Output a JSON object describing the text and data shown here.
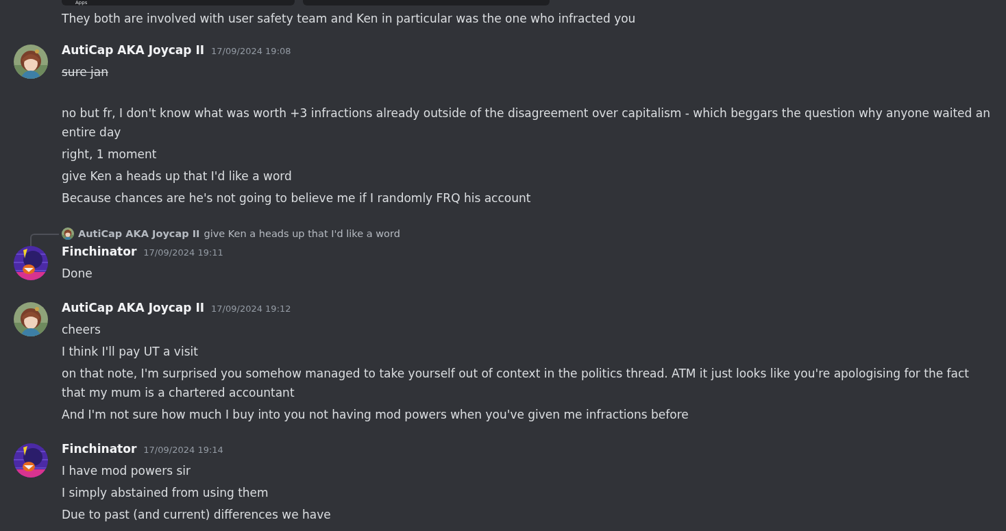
{
  "embed_strip": {
    "label": "Apps"
  },
  "continued_messages": [
    {
      "text": "They both are involved with user safety team and Ken in particular was the one who infracted you",
      "strikethrough": false
    }
  ],
  "groups": [
    {
      "author": "AutiCap AKA Joycap II",
      "avatar": {
        "kind": "auticap"
      },
      "timestamp": "17/09/2024 19:08",
      "messages": [
        {
          "text": "sure jan",
          "strikethrough": true
        },
        {
          "text": "no but fr, I don't know what was worth +3 infractions already outside of the disagreement over capitalism - which beggars the question why anyone waited an entire day",
          "strikethrough": false
        },
        {
          "text": "right, 1 moment",
          "strikethrough": false
        },
        {
          "text": "give Ken a heads up that I'd like a word",
          "strikethrough": false
        },
        {
          "text": "Because chances are he's not going to believe me if I randomly FRQ his account",
          "strikethrough": false
        }
      ]
    },
    {
      "author": "Finchinator",
      "avatar": {
        "kind": "finchinator"
      },
      "timestamp": "17/09/2024 19:11",
      "reply": {
        "author": "AutiCap AKA Joycap II",
        "avatar": {
          "kind": "auticap"
        },
        "text": "give Ken a heads up that I'd like a word"
      },
      "messages": [
        {
          "text": "Done",
          "strikethrough": false
        }
      ]
    },
    {
      "author": "AutiCap AKA Joycap II",
      "avatar": {
        "kind": "auticap"
      },
      "timestamp": "17/09/2024 19:12",
      "messages": [
        {
          "text": "cheers",
          "strikethrough": false
        },
        {
          "text": "I think I'll pay UT a visit",
          "strikethrough": false
        },
        {
          "text": "on that note, I'm surprised you somehow managed to take yourself out of context in the politics thread. ATM it just looks like you're apologising for the fact that my mum is a chartered accountant",
          "strikethrough": false
        },
        {
          "text": "And I'm not sure how much I buy into you not having mod powers when you've given me infractions before",
          "strikethrough": false
        }
      ]
    },
    {
      "author": "Finchinator",
      "avatar": {
        "kind": "finchinator"
      },
      "timestamp": "17/09/2024 19:14",
      "messages": [
        {
          "text": "I have mod powers sir",
          "strikethrough": false
        },
        {
          "text": "I simply abstained from using them",
          "strikethrough": false
        },
        {
          "text": "Due to past (and current) differences we have",
          "strikethrough": false
        }
      ]
    }
  ]
}
